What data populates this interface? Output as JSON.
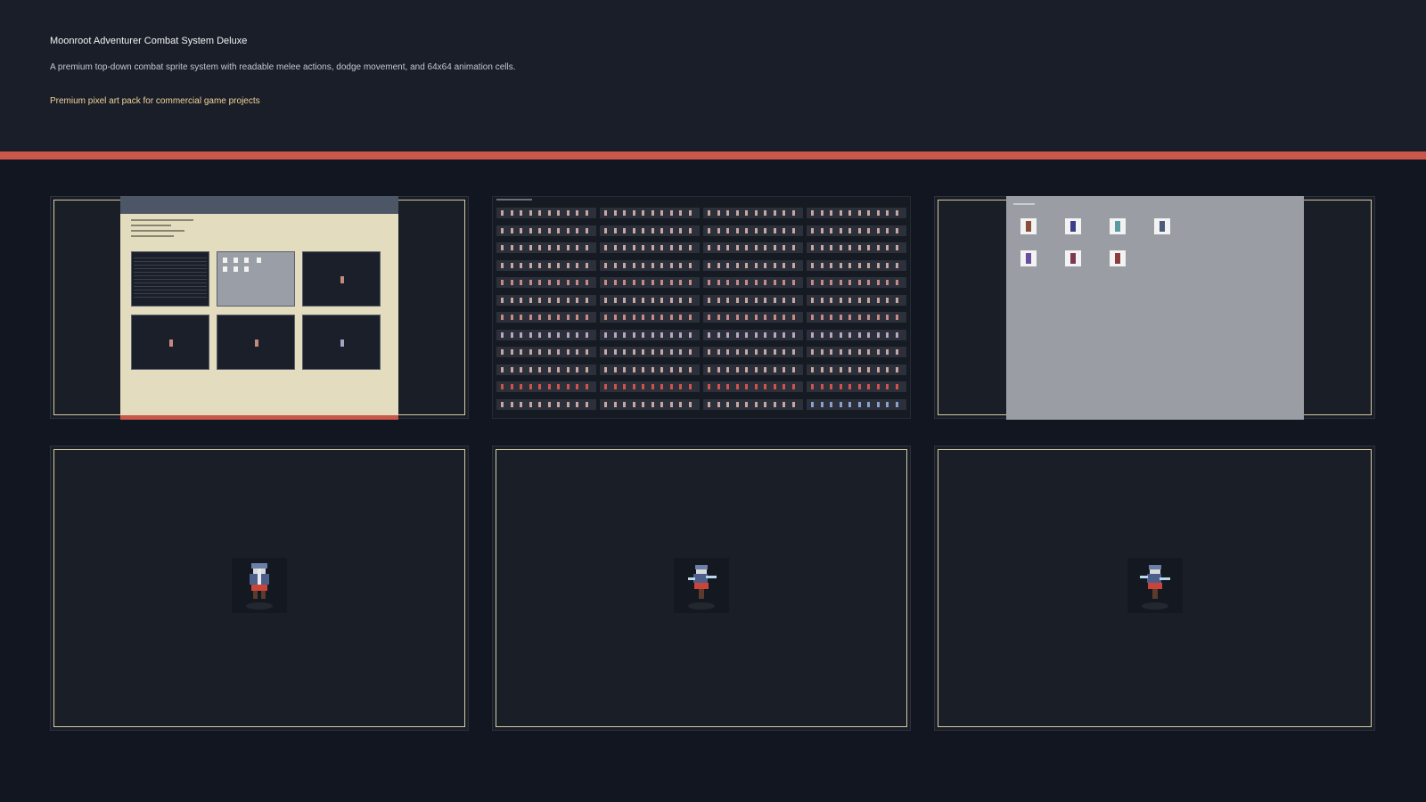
{
  "header": {
    "title": "Moonroot Adventurer Combat System Deluxe",
    "subtitle": "A premium top-down combat sprite system with readable melee actions, dodge movement, and 64x64 animation cells.",
    "tagline": "Premium pixel art pack for commercial game projects"
  },
  "colors": {
    "accent": "#c9574a",
    "background": "#121620",
    "frame": "#d6cba3",
    "tagline": "#f0d59a"
  },
  "previews": [
    {
      "id": "overview-sheet",
      "kind": "document"
    },
    {
      "id": "animation-sheet",
      "kind": "sprite-sheet"
    },
    {
      "id": "character-variants",
      "kind": "palette-select"
    },
    {
      "id": "idle-preview",
      "kind": "sprite",
      "pose": "front"
    },
    {
      "id": "attack-preview",
      "kind": "sprite",
      "pose": "attack"
    },
    {
      "id": "attack-preview-2",
      "kind": "sprite",
      "pose": "attack"
    }
  ]
}
